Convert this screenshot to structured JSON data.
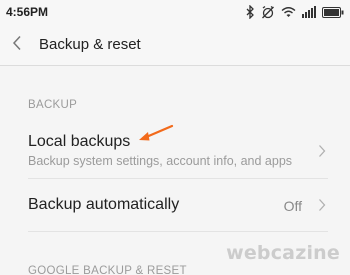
{
  "status_bar": {
    "time": "4:56PM",
    "icons": [
      "bluetooth-icon",
      "alarm-muted-icon",
      "wifi-icon",
      "signal-icon",
      "battery-icon"
    ]
  },
  "header": {
    "title": "Backup & reset",
    "back_icon": "chevron-left-icon"
  },
  "sections": [
    {
      "header": "BACKUP",
      "items": [
        {
          "title": "Local backups",
          "subtitle": "Backup system settings, account info, and apps"
        },
        {
          "title": "Backup automatically",
          "value": "Off"
        }
      ]
    },
    {
      "header": "GOOGLE BACKUP & RESET"
    }
  ],
  "annotation": {
    "icon": "orange-arrow-icon",
    "color": "#f26a1b"
  },
  "watermark": "webcazine",
  "colors": {
    "background": "#f5f5f5",
    "title_text": "#222222",
    "secondary_text": "#9b9b9b",
    "accent_annotation": "#f26a1b"
  }
}
